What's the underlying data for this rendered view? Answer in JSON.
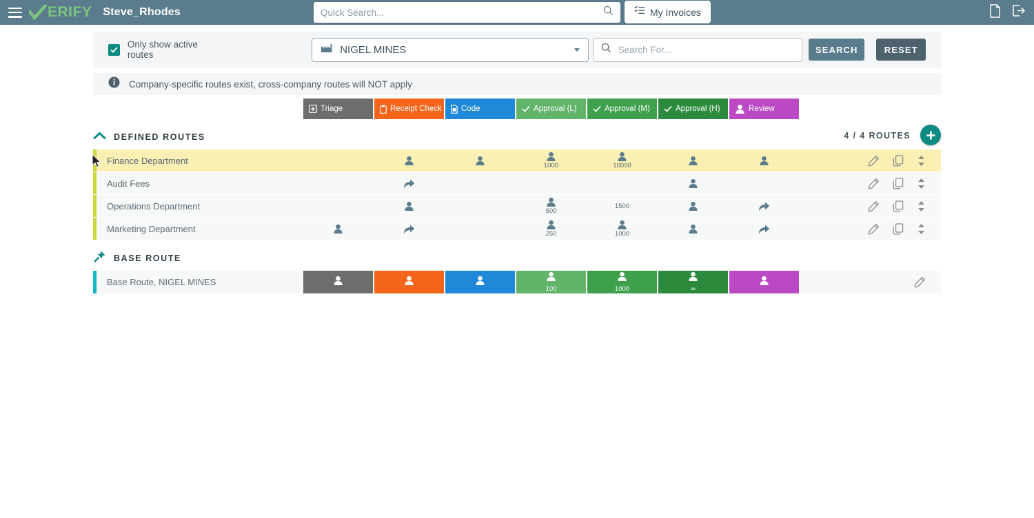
{
  "header": {
    "menu_icon": "hamburger-icon",
    "logo_text": "ERIFY",
    "logo_full": "VERIFY",
    "username": "Steve_Rhodes",
    "quick_search_placeholder": "Quick Search...",
    "quick_search_value": "",
    "search_icon": "search-icon",
    "my_invoices_label": "My Invoices",
    "my_invoices_icon": "list-check-icon",
    "document_icon": "document-icon",
    "logout_icon": "logout-icon",
    "bg_color": "#5b7c8d",
    "logo_color": "#7cc47f"
  },
  "filters": {
    "active_routes_label": "Only show active routes",
    "active_routes_checked": true,
    "checkbox_color": "#0d8a82",
    "company_icon": "factory-icon",
    "company_value": "NIGEL MINES",
    "company_caret_icon": "chevron-down-icon",
    "search_for_placeholder": "Search For...",
    "search_for_value": "",
    "search_button_label": "SEARCH",
    "reset_button_label": "RESET"
  },
  "info": {
    "icon": "info-icon",
    "message": "Company-specific routes exist, cross-company routes will NOT apply"
  },
  "stages": [
    {
      "label": "Triage",
      "icon": "grid-icon",
      "color": "#6d6d6d"
    },
    {
      "label": "Receipt Check",
      "icon": "clipboard-icon",
      "color": "#f4651a"
    },
    {
      "label": "Code",
      "icon": "file-icon",
      "color": "#2088d8"
    },
    {
      "label": "Approval (L)",
      "icon": "check-icon",
      "color": "#62b46a"
    },
    {
      "label": "Approval (M)",
      "icon": "check-icon",
      "color": "#3ea04c"
    },
    {
      "label": "Approval (H)",
      "icon": "check-icon",
      "color": "#2c8a3c"
    },
    {
      "label": "Review",
      "icon": "person-icon",
      "color": "#bb49c4"
    }
  ],
  "defined_routes": {
    "section_label": "DEFINED ROUTES",
    "section_icon": "chevron-up-icon",
    "count_label": "4 / 4 ROUTES",
    "add_icon": "plus-icon",
    "accent_color": "#cdd541",
    "highlight_color": "#faf0b4",
    "rows": [
      {
        "name": "Finance Department",
        "highlighted": true,
        "cells": [
          {
            "icon": "",
            "value": ""
          },
          {
            "icon": "person-icon",
            "value": ""
          },
          {
            "icon": "person-icon",
            "value": ""
          },
          {
            "icon": "person-icon",
            "value": "1000"
          },
          {
            "icon": "person-icon",
            "value": "10000"
          },
          {
            "icon": "person-icon",
            "value": ""
          },
          {
            "icon": "person-icon",
            "value": ""
          }
        ],
        "actions": [
          "edit-icon",
          "copy-icon",
          "reorder-icon"
        ]
      },
      {
        "name": "Audit Fees",
        "highlighted": false,
        "cells": [
          {
            "icon": "",
            "value": ""
          },
          {
            "icon": "forward-arrow-icon",
            "value": ""
          },
          {
            "icon": "",
            "value": ""
          },
          {
            "icon": "",
            "value": ""
          },
          {
            "icon": "",
            "value": ""
          },
          {
            "icon": "person-icon",
            "value": ""
          },
          {
            "icon": "",
            "value": ""
          }
        ],
        "actions": [
          "edit-icon",
          "copy-icon",
          "reorder-icon"
        ]
      },
      {
        "name": "Operations Department",
        "highlighted": false,
        "cells": [
          {
            "icon": "",
            "value": ""
          },
          {
            "icon": "person-icon",
            "value": ""
          },
          {
            "icon": "",
            "value": ""
          },
          {
            "icon": "person-icon",
            "value": "500"
          },
          {
            "icon": "",
            "value": "1500"
          },
          {
            "icon": "person-icon",
            "value": ""
          },
          {
            "icon": "forward-arrow-icon",
            "value": ""
          }
        ],
        "actions": [
          "edit-icon",
          "copy-icon",
          "reorder-icon"
        ]
      },
      {
        "name": "Marketing Department",
        "highlighted": false,
        "cells": [
          {
            "icon": "person-icon",
            "value": ""
          },
          {
            "icon": "forward-arrow-icon",
            "value": ""
          },
          {
            "icon": "",
            "value": ""
          },
          {
            "icon": "person-icon",
            "value": "250"
          },
          {
            "icon": "person-icon",
            "value": "1000"
          },
          {
            "icon": "person-icon",
            "value": ""
          },
          {
            "icon": "forward-arrow-icon",
            "value": ""
          }
        ],
        "actions": [
          "edit-icon",
          "copy-icon",
          "reorder-icon"
        ]
      }
    ]
  },
  "base_route": {
    "section_label": "BASE ROUTE",
    "section_icon": "pin-icon",
    "accent_color": "#16b5c4",
    "name": "Base Route, NIGEL MINES",
    "cells": [
      {
        "icon": "person-icon",
        "value": "",
        "color": "#6d6d6d"
      },
      {
        "icon": "person-icon",
        "value": "",
        "color": "#f4651a"
      },
      {
        "icon": "person-icon",
        "value": "",
        "color": "#2088d8"
      },
      {
        "icon": "person-icon",
        "value": "100",
        "color": "#62b46a"
      },
      {
        "icon": "person-icon",
        "value": "1000",
        "color": "#3ea04c"
      },
      {
        "icon": "person-icon",
        "value": "∞",
        "color": "#2c8a3c"
      },
      {
        "icon": "person-icon",
        "value": "",
        "color": "#bb49c4"
      }
    ],
    "actions": [
      "edit-icon"
    ]
  }
}
